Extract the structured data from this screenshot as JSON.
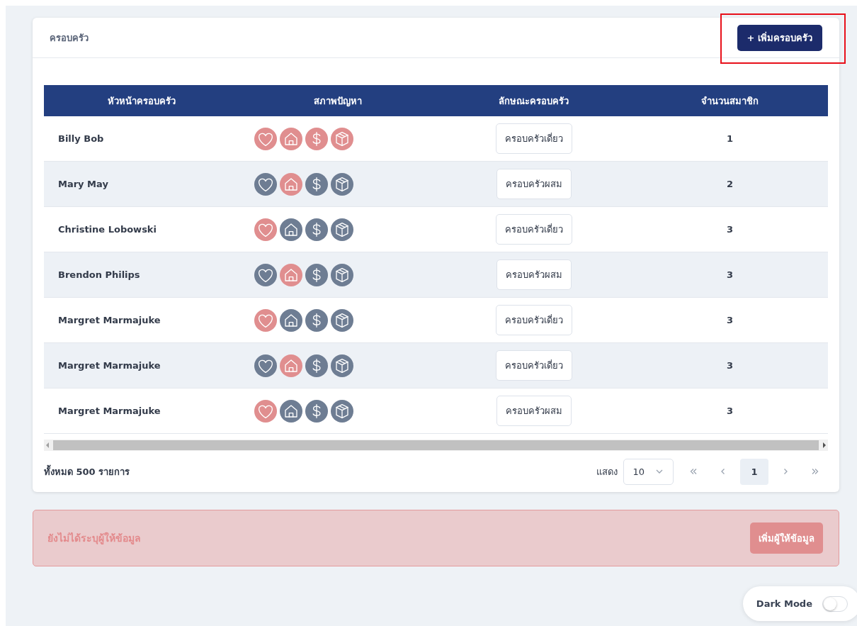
{
  "card": {
    "title": "ครอบครัว",
    "add_button": {
      "label": "+ เพิ่มครอบครัว",
      "highlighted": true
    }
  },
  "table": {
    "columns": [
      "หัวหน้าครอบครัว",
      "สภาพปัญหา",
      "ลักษณะครอบครัว",
      "จำนวนสมาชิก"
    ],
    "rows": [
      {
        "head": "Billy Bob",
        "issues": [
          {
            "kind": "health",
            "on": true
          },
          {
            "kind": "housing",
            "on": true
          },
          {
            "kind": "money",
            "on": true
          },
          {
            "kind": "goods",
            "on": true
          }
        ],
        "family_type": "ครอบครัวเดี่ยว",
        "members": "1"
      },
      {
        "head": "Mary May",
        "issues": [
          {
            "kind": "health",
            "on": false
          },
          {
            "kind": "housing",
            "on": true
          },
          {
            "kind": "money",
            "on": false
          },
          {
            "kind": "goods",
            "on": false
          }
        ],
        "family_type": "ครอบครัวผสม",
        "members": "2"
      },
      {
        "head": "Christine Lobowski",
        "issues": [
          {
            "kind": "health",
            "on": true
          },
          {
            "kind": "housing",
            "on": false
          },
          {
            "kind": "money",
            "on": false
          },
          {
            "kind": "goods",
            "on": false
          }
        ],
        "family_type": "ครอบครัวเดี่ยว",
        "members": "3"
      },
      {
        "head": "Brendon Philips",
        "issues": [
          {
            "kind": "health",
            "on": false
          },
          {
            "kind": "housing",
            "on": true
          },
          {
            "kind": "money",
            "on": false
          },
          {
            "kind": "goods",
            "on": false
          }
        ],
        "family_type": "ครอบครัวผสม",
        "members": "3"
      },
      {
        "head": "Margret Marmajuke",
        "issues": [
          {
            "kind": "health",
            "on": true
          },
          {
            "kind": "housing",
            "on": false
          },
          {
            "kind": "money",
            "on": false
          },
          {
            "kind": "goods",
            "on": false
          }
        ],
        "family_type": "ครอบครัวเดี่ยว",
        "members": "3"
      },
      {
        "head": "Margret Marmajuke",
        "issues": [
          {
            "kind": "health",
            "on": false
          },
          {
            "kind": "housing",
            "on": true
          },
          {
            "kind": "money",
            "on": false
          },
          {
            "kind": "goods",
            "on": false
          }
        ],
        "family_type": "ครอบครัวเดี่ยว",
        "members": "3"
      },
      {
        "head": "Margret Marmajuke",
        "issues": [
          {
            "kind": "health",
            "on": true
          },
          {
            "kind": "housing",
            "on": false
          },
          {
            "kind": "money",
            "on": false
          },
          {
            "kind": "goods",
            "on": false
          }
        ],
        "family_type": "ครอบครัวผสม",
        "members": "3"
      }
    ]
  },
  "footer": {
    "total": "ทั้งหมด 500 รายการ",
    "page_size_label": "แสดง",
    "page_size": "10",
    "pages": [
      {
        "label": "1",
        "selected": true
      }
    ]
  },
  "alert": {
    "message": "ยังไม่ได้ระบุผู้ให้ข้อมูล",
    "button": "เพิ่มผู้ให้ข้อมูล"
  },
  "dark_mode": {
    "label": "Dark Mode",
    "on": false
  }
}
